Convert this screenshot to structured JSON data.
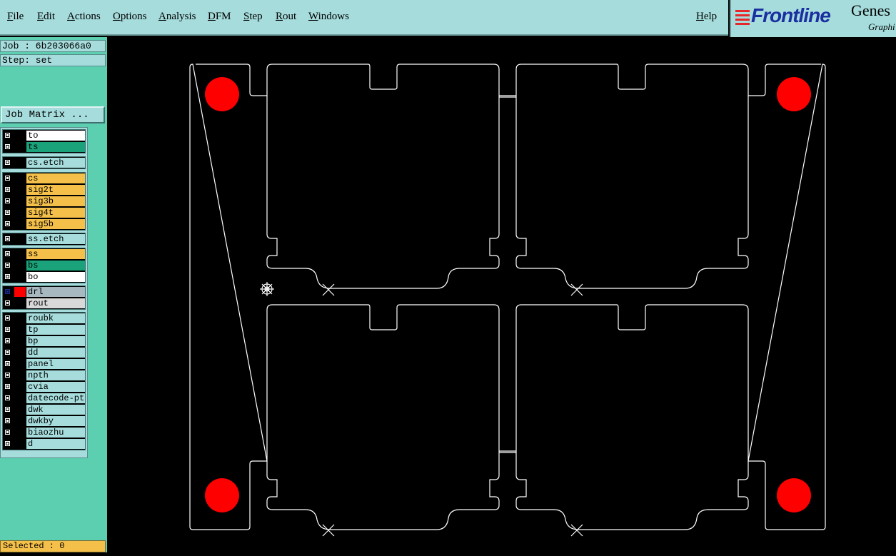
{
  "menu": {
    "items": [
      "File",
      "Edit",
      "Actions",
      "Options",
      "Analysis",
      "DFM",
      "Step",
      "Rout",
      "Windows"
    ],
    "help": "Help"
  },
  "logo": {
    "brand": "Frontline",
    "product": "Genes",
    "sub": "Graphi"
  },
  "panel": {
    "job": "Job : 6b203066a0",
    "step": "Step: set",
    "job_matrix": "Job Matrix ..."
  },
  "layers": {
    "g1": [
      {
        "name": "to",
        "color": "#ffffff"
      },
      {
        "name": "ts",
        "color": "#1aa37a"
      }
    ],
    "g2": [
      {
        "name": "cs.etch",
        "color": "#a6dcdc"
      }
    ],
    "g3": [
      {
        "name": "cs",
        "color": "#f5c04a"
      },
      {
        "name": "sig2t",
        "color": "#f5c04a"
      },
      {
        "name": "sig3b",
        "color": "#f5c04a"
      },
      {
        "name": "sig4t",
        "color": "#f5c04a"
      },
      {
        "name": "sig5b",
        "color": "#f5c04a"
      }
    ],
    "g4": [
      {
        "name": "ss.etch",
        "color": "#a6dcdc"
      }
    ],
    "g5": [
      {
        "name": "ss",
        "color": "#f5c04a"
      },
      {
        "name": "bs",
        "color": "#1aa37a"
      },
      {
        "name": "bo",
        "color": "#ffffff"
      }
    ],
    "g6": [
      {
        "name": "drl",
        "color": "#a8b8c0",
        "active": true
      },
      {
        "name": "rout",
        "color": "#d8d8d8"
      }
    ],
    "g7": [
      {
        "name": "roubk",
        "color": "#a6dcdc"
      },
      {
        "name": "tp",
        "color": "#a6dcdc"
      },
      {
        "name": "bp",
        "color": "#a6dcdc"
      },
      {
        "name": "dd",
        "color": "#a6dcdc"
      },
      {
        "name": "panel",
        "color": "#a6dcdc"
      },
      {
        "name": "npth",
        "color": "#a6dcdc"
      },
      {
        "name": "cvia",
        "color": "#a6dcdc"
      },
      {
        "name": "datecode-pto",
        "color": "#a6dcdc"
      },
      {
        "name": "dwk",
        "color": "#a6dcdc"
      },
      {
        "name": "dwkby",
        "color": "#a6dcdc"
      },
      {
        "name": "biaozhu",
        "color": "#a6dcdc"
      },
      {
        "name": "d",
        "color": "#a6dcdc"
      }
    ]
  },
  "status": {
    "selected": "Selected : 0"
  },
  "colors": {
    "menu_bg": "#a6dcdc",
    "panel_bg": "#5ccfb0",
    "drill_fill": "#ff0000",
    "outline": "#ffffff"
  }
}
